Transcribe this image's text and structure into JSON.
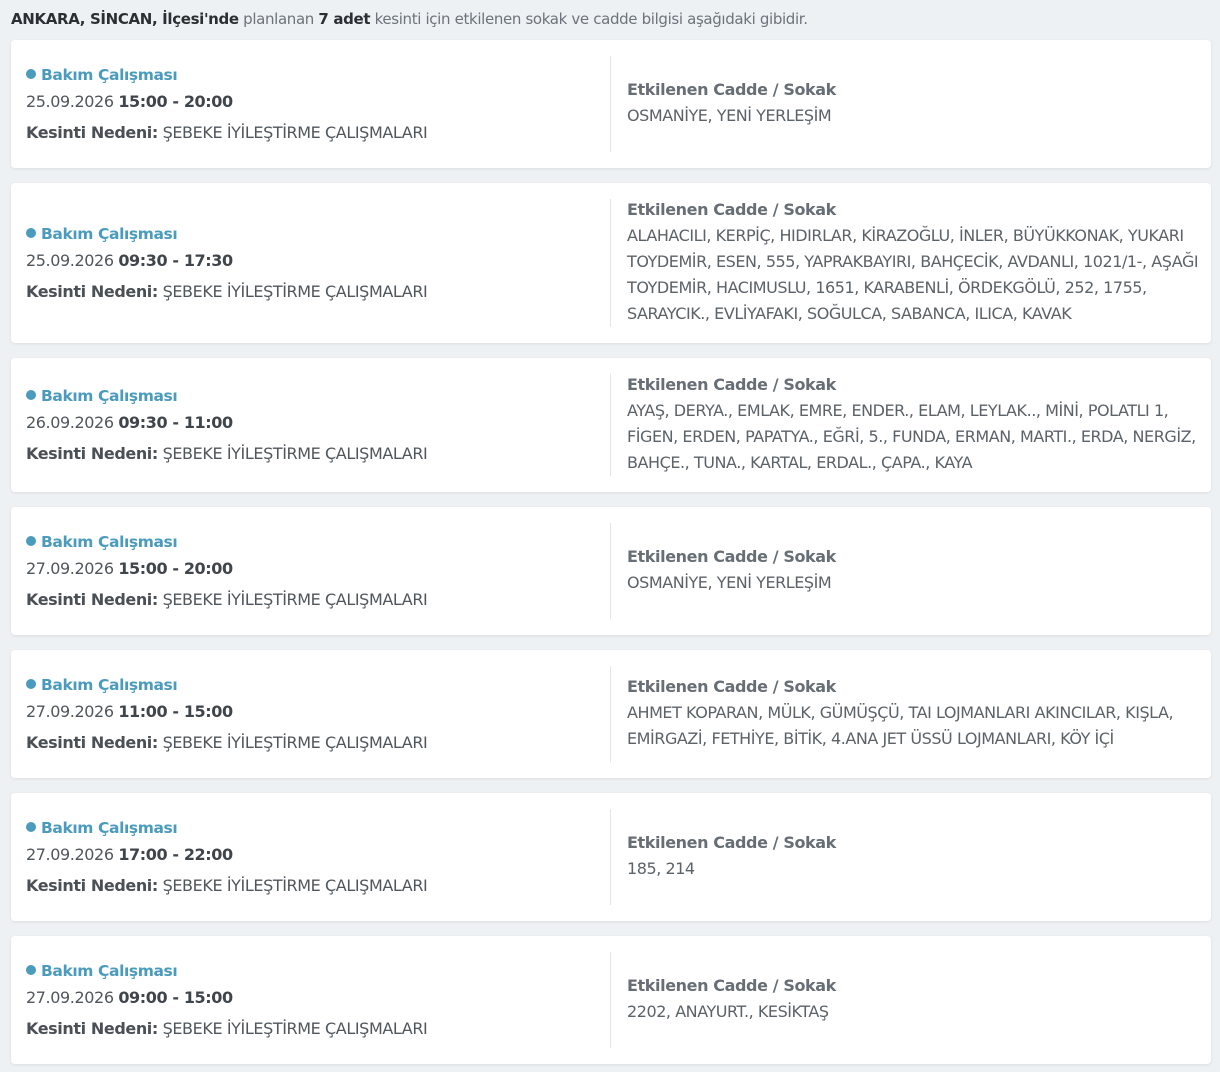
{
  "summary": {
    "location": "ANKARA, SİNCAN, İlçesi'nde",
    "planned": "planlanan",
    "count": "7 adet",
    "rest": "kesinti için etkilenen sokak ve cadde bilgisi aşağıdaki gibidir."
  },
  "labels": {
    "streets_title": "Etkilenen Cadde / Sokak",
    "reason_label": "Kesinti Nedeni:"
  },
  "outages": [
    {
      "type": "Bakım Çalışması",
      "date": "25.09.2026",
      "hours": "15:00 - 20:00",
      "reason": "ŞEBEKE İYİLEŞTİRME ÇALIŞMALARI",
      "streets": "OSMANİYE, YENİ YERLEŞİM"
    },
    {
      "type": "Bakım Çalışması",
      "date": "25.09.2026",
      "hours": "09:30 - 17:30",
      "reason": "ŞEBEKE İYİLEŞTİRME ÇALIŞMALARI",
      "streets": "ALAHACILI, KERPİÇ, HIDIRLAR, KİRAZOĞLU, İNLER, BÜYÜKKONAK, YUKARI TOYDEMİR, ESEN, 555, YAPRAKBAYIRI, BAHÇECİK, AVDANLI, 1021/1-, AŞAĞI TOYDEMİR, HACIMUSLU, 1651, KARABENLİ, ÖRDEKGÖLÜ, 252, 1755, SARAYCIK., EVLİYAFAKI, SOĞULCA, SABANCA, ILICA, KAVAK"
    },
    {
      "type": "Bakım Çalışması",
      "date": "26.09.2026",
      "hours": "09:30 - 11:00",
      "reason": "ŞEBEKE İYİLEŞTİRME ÇALIŞMALARI",
      "streets": "AYAŞ, DERYA., EMLAK, EMRE, ENDER., ELAM, LEYLAK.., MİNİ, POLATLI 1, FİGEN, ERDEN, PAPATYA., EĞRİ, 5., FUNDA, ERMAN, MARTI., ERDA, NERGİZ, BAHÇE., TUNA., KARTAL, ERDAL., ÇAPA., KAYA"
    },
    {
      "type": "Bakım Çalışması",
      "date": "27.09.2026",
      "hours": "15:00 - 20:00",
      "reason": "ŞEBEKE İYİLEŞTİRME ÇALIŞMALARI",
      "streets": "OSMANİYE, YENİ YERLEŞİM"
    },
    {
      "type": "Bakım Çalışması",
      "date": "27.09.2026",
      "hours": "11:00 - 15:00",
      "reason": "ŞEBEKE İYİLEŞTİRME ÇALIŞMALARI",
      "streets": "AHMET KOPARAN, MÜLK, GÜMÜŞÇÜ, TAI LOJMANLARI AKINCILAR, KIŞLA, EMİRGAZİ, FETHİYE, BİTİK, 4.ANA JET ÜSSÜ LOJMANLARI, KÖY İÇİ"
    },
    {
      "type": "Bakım Çalışması",
      "date": "27.09.2026",
      "hours": "17:00 - 22:00",
      "reason": "ŞEBEKE İYİLEŞTİRME ÇALIŞMALARI",
      "streets": "185, 214"
    },
    {
      "type": "Bakım Çalışması",
      "date": "27.09.2026",
      "hours": "09:00 - 15:00",
      "reason": "ŞEBEKE İYİLEŞTİRME ÇALIŞMALARI",
      "streets": "2202, ANAYURT., KESİKTAŞ"
    }
  ],
  "colors": {
    "accent": "#4a9bbd",
    "background": "#eef1f4",
    "card": "#ffffff"
  }
}
